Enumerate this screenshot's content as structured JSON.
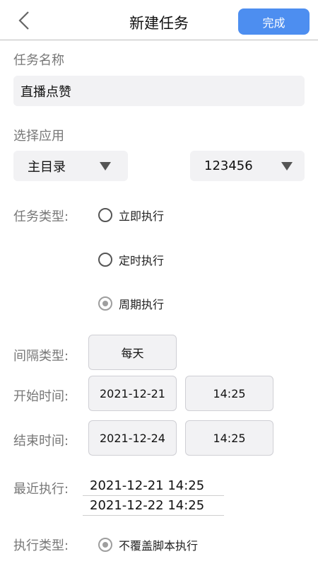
{
  "header": {
    "title": "新建任务",
    "done_label": "完成"
  },
  "task_name": {
    "label": "任务名称",
    "value": "直播点赞"
  },
  "app_select": {
    "label": "选择应用",
    "app": "主目录",
    "account": "123456"
  },
  "task_type": {
    "label": "任务类型:",
    "options": [
      {
        "label": "立即执行",
        "checked": false
      },
      {
        "label": "定时执行",
        "checked": false
      },
      {
        "label": "周期执行",
        "checked": true
      }
    ]
  },
  "interval": {
    "label": "间隔类型:",
    "value": "每天"
  },
  "start": {
    "label": "开始时间:",
    "date": "2021-12-21",
    "time": "14:25"
  },
  "end": {
    "label": "结束时间:",
    "date": "2021-12-24",
    "time": "14:25"
  },
  "recent": {
    "label": "最近执行:",
    "items": [
      "2021-12-21 14:25",
      "2021-12-22 14:25"
    ]
  },
  "exec_type": {
    "label": "执行类型:",
    "option": "不覆盖脚本执行"
  },
  "colors": {
    "accent": "#4d8ef0",
    "field_bg": "#f2f2f4"
  }
}
